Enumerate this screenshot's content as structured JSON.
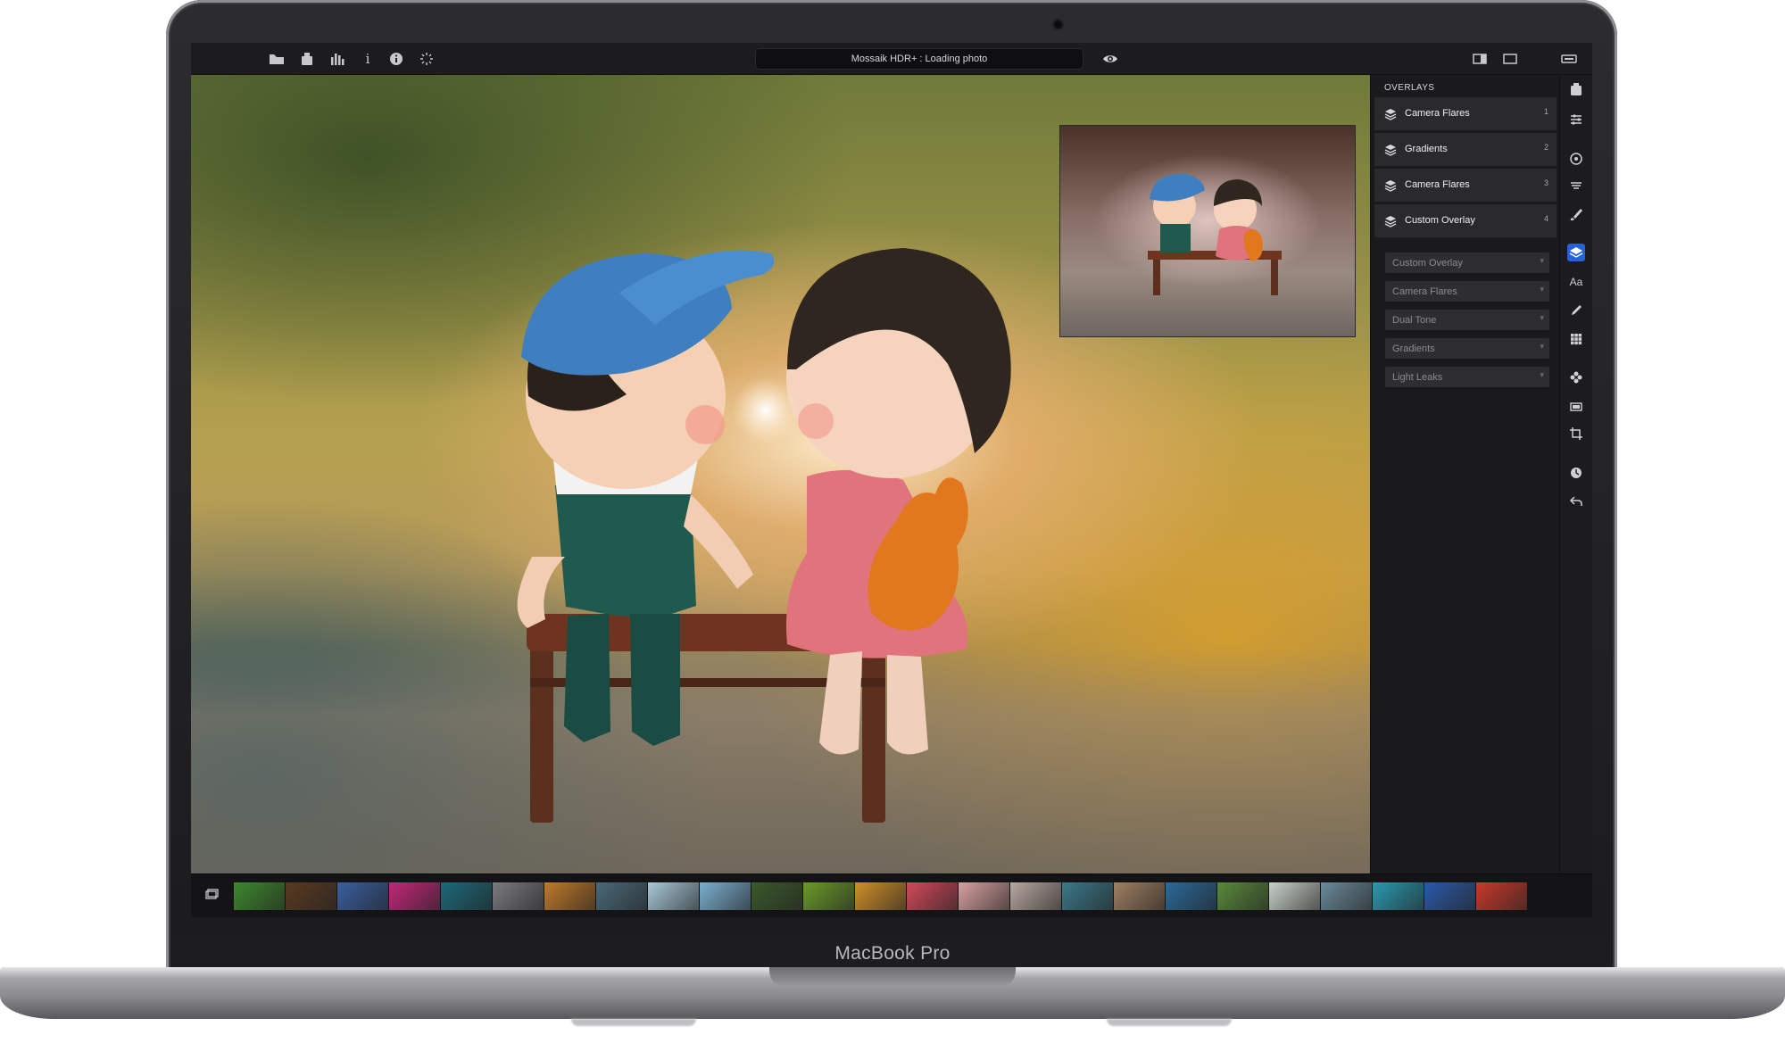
{
  "device": {
    "brand_label": "MacBook Pro"
  },
  "app": {
    "window_title": "Mossaik HDR+ : Loading photo"
  },
  "toolbar": {
    "left_icons": [
      "open-folder-icon",
      "export-icon",
      "histogram-icon",
      "info-text-icon",
      "info-circle-icon",
      "magic-wand-icon"
    ],
    "right_icons": [
      "eye-icon",
      "split-view-icon",
      "single-view-icon",
      "fullscreen-icon"
    ]
  },
  "overlays_panel": {
    "title": "OVERLAYS",
    "layers": [
      {
        "name": "Camera Flares",
        "index": "1"
      },
      {
        "name": "Gradients",
        "index": "2"
      },
      {
        "name": "Camera Flares",
        "index": "3"
      },
      {
        "name": "Custom Overlay",
        "index": "4"
      }
    ],
    "options": [
      "Custom Overlay",
      "Camera Flares",
      "Dual Tone",
      "Gradients",
      "Light Leaks"
    ]
  },
  "tool_strip": {
    "icons": [
      "presets-icon",
      "adjustments-icon",
      "lens-icon",
      "filters-icon",
      "brush-icon",
      "layers-icon",
      "text-icon",
      "retouch-icon",
      "grid-icon",
      "effects-icon",
      "frames-icon",
      "crop-icon",
      "history-icon",
      "undo-icon"
    ],
    "text_tool_label": "Aa",
    "active": "layers-icon"
  },
  "filmstrip": {
    "thumb_colors": [
      "#3d8a2c",
      "#5a3a20",
      "#3a5fa0",
      "#c0287a",
      "#1c6a7a",
      "#7a7a80",
      "#c07a2a",
      "#4a6a7a",
      "#a8c8d8",
      "#7ab0d0",
      "#3a5a2a",
      "#6a9a2a",
      "#d0902a",
      "#d04a5a",
      "#d8a0a0",
      "#b8a8a0",
      "#3a7a8a",
      "#a08060",
      "#2a6a9a",
      "#5a8a3a",
      "#c8d0c8",
      "#6a8a9a",
      "#2a9ab0",
      "#2a5aa8",
      "#c83a2a"
    ]
  },
  "accent_color": "#2563d6"
}
